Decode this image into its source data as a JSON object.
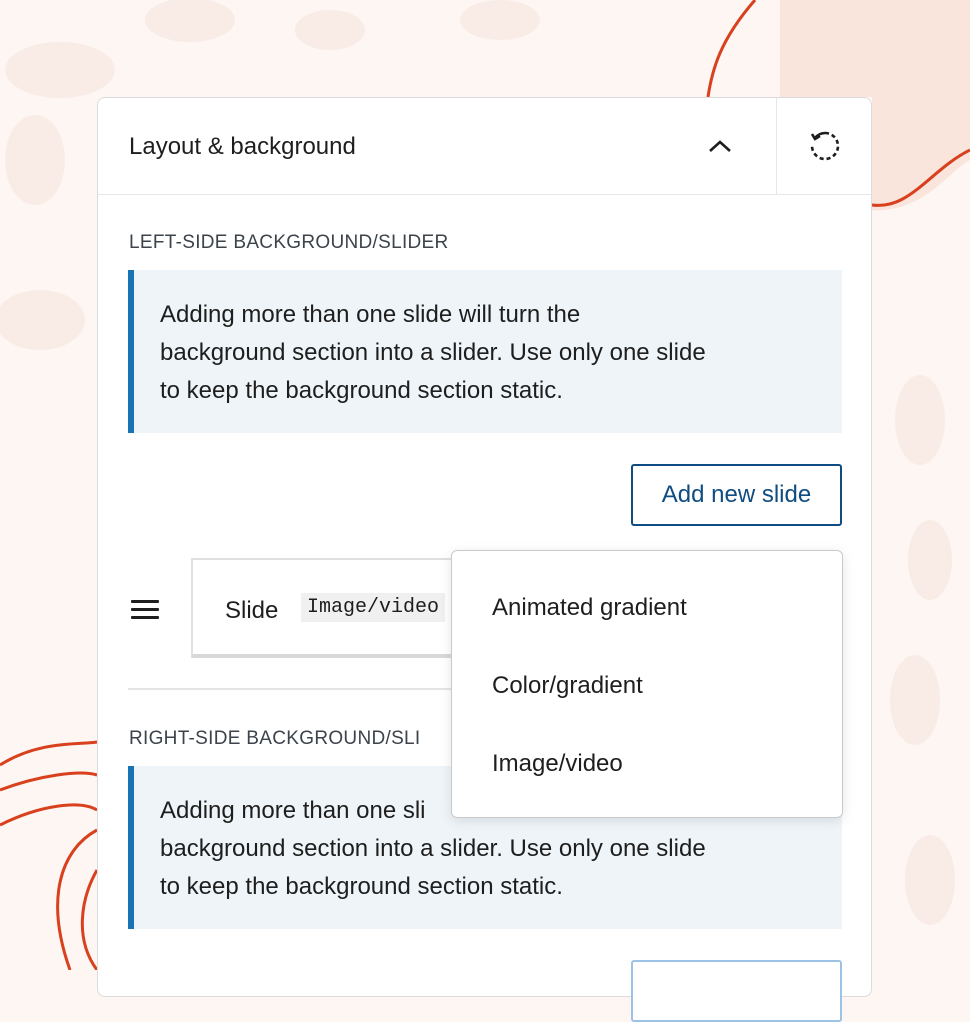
{
  "panel": {
    "title": "Layout & background",
    "toggle_icon": "chevron-up-icon",
    "reset_icon": "reset-icon"
  },
  "left_section": {
    "label": "LEFT-SIDE BACKGROUND/SLIDER",
    "notice_lines": [
      "Adding more than one slide will turn the",
      "background section into a slider. Use only one slide",
      "to keep the background section static."
    ],
    "add_button": "Add new slide",
    "slide": {
      "label": "Slide",
      "type": "Image/video"
    }
  },
  "right_section": {
    "label": "RIGHT-SIDE BACKGROUND/SLI",
    "notice_lines": [
      "Adding more than one sli",
      "background section into a slider. Use only one slide",
      "to keep the background section static."
    ]
  },
  "dropdown": {
    "options": [
      "Animated gradient",
      "Color/gradient",
      "Image/video"
    ]
  },
  "colors": {
    "accent": "#0f4c81",
    "notice_border": "#1a73b5",
    "notice_bg": "#eef4f8",
    "decor_line": "#d9401e"
  }
}
